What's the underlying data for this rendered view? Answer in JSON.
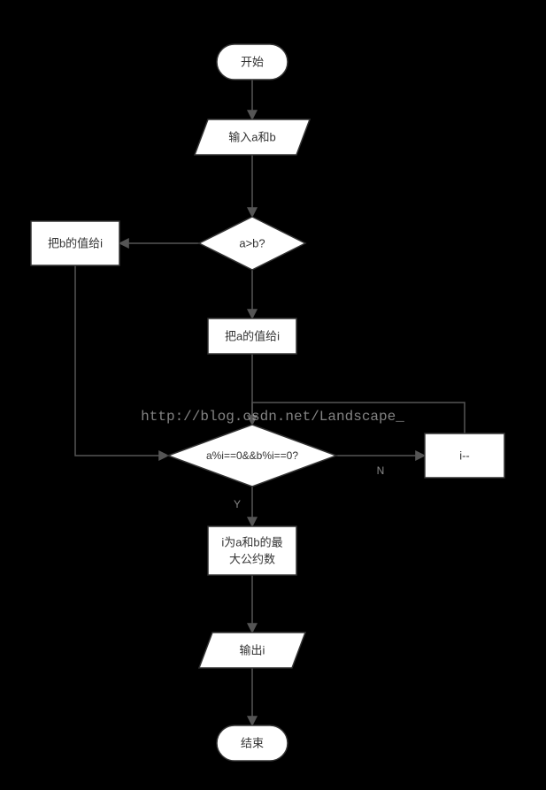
{
  "chart_data": {
    "type": "flowchart",
    "title": "",
    "nodes": [
      {
        "id": "start",
        "shape": "terminal",
        "label": "开始"
      },
      {
        "id": "input",
        "shape": "io",
        "label": "输入a和b"
      },
      {
        "id": "cmp",
        "shape": "decision",
        "label": "a>b?"
      },
      {
        "id": "assign_b",
        "shape": "process",
        "label": "把b的值给i"
      },
      {
        "id": "assign_a",
        "shape": "process",
        "label": "把a的值给i"
      },
      {
        "id": "mod",
        "shape": "decision",
        "label": "a%i==0&&b%i==0?"
      },
      {
        "id": "dec",
        "shape": "process",
        "label": "i--"
      },
      {
        "id": "gcd",
        "shape": "process",
        "label": "i为a和b的最\n大公约数"
      },
      {
        "id": "output",
        "shape": "io",
        "label": "输出i"
      },
      {
        "id": "end",
        "shape": "terminal",
        "label": "结束"
      }
    ],
    "edges": [
      {
        "from": "start",
        "to": "input"
      },
      {
        "from": "input",
        "to": "cmp"
      },
      {
        "from": "cmp",
        "to": "assign_b",
        "dir": "left"
      },
      {
        "from": "cmp",
        "to": "assign_a",
        "dir": "down"
      },
      {
        "from": "assign_a",
        "to": "mod"
      },
      {
        "from": "assign_b",
        "to": "mod"
      },
      {
        "from": "mod",
        "to": "dec",
        "label": "N",
        "dir": "right"
      },
      {
        "from": "dec",
        "to": "mod",
        "dir": "loop"
      },
      {
        "from": "mod",
        "to": "gcd",
        "label": "Y",
        "dir": "down"
      },
      {
        "from": "gcd",
        "to": "output"
      },
      {
        "from": "output",
        "to": "end"
      }
    ]
  },
  "labels": {
    "start": "开始",
    "input": "输入a和b",
    "cmp": "a>b?",
    "assign_b": "把b的值给i",
    "assign_a": "把a的值给i",
    "mod": "a%i==0&&b%i==0?",
    "dec": "i--",
    "gcd_line1": "i为a和b的最",
    "gcd_line2": "大公约数",
    "output": "输出i",
    "end": "结束",
    "edge_N": "N",
    "edge_Y": "Y"
  },
  "watermark": "http://blog.csdn.net/Landscape_"
}
